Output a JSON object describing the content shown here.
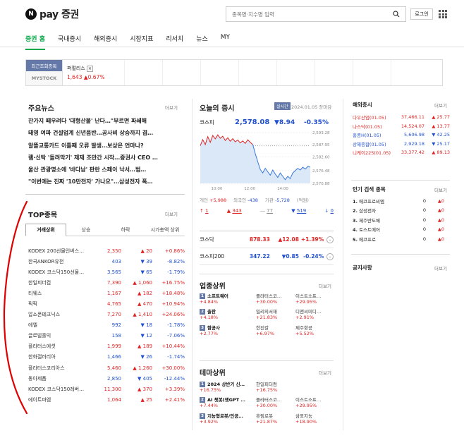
{
  "header": {
    "logo_badge": "N",
    "logo_text": "pay 증권",
    "search_placeholder": "종목명·지수명 입력",
    "login": "로그인"
  },
  "nav": [
    "증권 홈",
    "국내증시",
    "해외증시",
    "시장지표",
    "리서치",
    "뉴스",
    "MY"
  ],
  "recent": {
    "title": "최근조회종목",
    "sub": "MYSTOCK",
    "stock_name": "퍼펄리스",
    "stock_price": "1,643",
    "stock_change": "▲0.67%"
  },
  "news": {
    "title": "주요뉴스",
    "more": "더보기",
    "items": [
      "잔가지 떼우려다 '대형산불' 난다…\"부르면 파쇄해",
      "태영 여파 건설업계 신년음반…공사비 상승까지 겹…",
      "알뜰교통카드 이틀째 오류 발생…보상은 언마나?",
      "램·신탁 '돌려막기' 제재 조만간 시작…증권사 CEO …",
      "울산 관광명소에 '바다남' 판란 스페이 낙서…범…",
      "\"이번에는 진짜 '10만전자' 가나요\"…삼성전자 폭…"
    ]
  },
  "top": {
    "title": "TOP종목",
    "more": "더보기",
    "tabs": [
      "거래상위",
      "상승",
      "하락",
      "시가총액 상위"
    ],
    "rows": [
      {
        "name": "KODEX 200선물인버스…",
        "price": "2,350",
        "change": "▲ 20",
        "rate": "+0.86%",
        "dir": "up"
      },
      {
        "name": "한국ANKOR유전",
        "price": "403",
        "change": "▼ 39",
        "rate": "-8.82%",
        "dir": "down"
      },
      {
        "name": "KODEX 코스닥150선물…",
        "price": "3,565",
        "change": "▼ 65",
        "rate": "-1.79%",
        "dir": "down"
      },
      {
        "name": "한일피더컴",
        "price": "7,390",
        "change": "▲ 1,060",
        "rate": "+16.75%",
        "dir": "up"
      },
      {
        "name": "티웨스",
        "price": "1,167",
        "change": "▲ 182",
        "rate": "+18.48%",
        "dir": "up"
      },
      {
        "name": "픽픽",
        "price": "4,765",
        "change": "▲ 470",
        "rate": "+10.94%",
        "dir": "up"
      },
      {
        "name": "압소폰테크닉스",
        "price": "7,270",
        "change": "▲ 1,410",
        "rate": "+24.06%",
        "dir": "up"
      },
      {
        "name": "에엘",
        "price": "992",
        "change": "▼ 18",
        "rate": "-1.78%",
        "dir": "down"
      },
      {
        "name": "글로벌홀익",
        "price": "158",
        "change": "▼ 12",
        "rate": "-7.06%",
        "dir": "down"
      },
      {
        "name": "플라터스에셋",
        "price": "1,999",
        "change": "▲ 189",
        "rate": "+10.44%",
        "dir": "up"
      },
      {
        "name": "한화갤러리아",
        "price": "1,466",
        "change": "▼ 26",
        "rate": "-1.74%",
        "dir": "down"
      },
      {
        "name": "플라터스코리아스",
        "price": "5,460",
        "change": "▲ 1,260",
        "rate": "+30.00%",
        "dir": "up"
      },
      {
        "name": "동아제품",
        "price": "2,850",
        "change": "▼ 405",
        "rate": "-12.44%",
        "dir": "down"
      },
      {
        "name": "KODEX 코스닥150레버…",
        "price": "11,300",
        "change": "▲ 370",
        "rate": "+3.39%",
        "dir": "up"
      },
      {
        "name": "에이트파엠",
        "price": "1,064",
        "change": "▲ 25",
        "rate": "+2.41%",
        "dir": "up"
      }
    ]
  },
  "market": {
    "title": "오늘의 증시",
    "badge": "실시간",
    "date": "2024.01.05 장마감",
    "kospi_label": "코스피",
    "kospi_value": "2,578.08",
    "kospi_change": "▼8.94",
    "kospi_rate": "-0.35%",
    "y_ticks": [
      "2,593.28",
      "2,587.95",
      "2,582.60",
      "2,576.48",
      "2,570.88"
    ],
    "x_ticks": [
      "10:00",
      "12:00",
      "14:00"
    ],
    "investors": [
      {
        "label": "개인",
        "value": "+5,988",
        "dir": "up"
      },
      {
        "label": "외국인",
        "value": "-438",
        "dir": "down"
      },
      {
        "label": "기관",
        "value": "-5,728",
        "dir": "down"
      },
      {
        "label": "",
        "value": "(억원)",
        "dir": "none"
      }
    ],
    "breadth": [
      {
        "sym": "↑",
        "value": "1",
        "dir": "up"
      },
      {
        "sym": "▲",
        "value": "343",
        "dir": "up"
      },
      {
        "sym": "―",
        "value": "77",
        "dir": "none"
      },
      {
        "sym": "▼",
        "value": "519",
        "dir": "down"
      },
      {
        "sym": "↓",
        "value": "0",
        "dir": "down"
      }
    ],
    "indices": [
      {
        "name": "코스닥",
        "value": "878.33",
        "change": "▲12.08",
        "rate": "+1.39%",
        "dir": "up"
      },
      {
        "name": "코스피200",
        "value": "347.22",
        "change": "▼0.85",
        "rate": "-0.24%",
        "dir": "down"
      }
    ]
  },
  "chart_data": {
    "type": "area",
    "title": "",
    "xlabel": "",
    "ylabel": "",
    "x_ticks": [
      "10:00",
      "12:00",
      "14:00"
    ],
    "y_ticks": [
      2593.28,
      2587.95,
      2582.6,
      2576.48,
      2570.88
    ],
    "ylim": [
      2570.88,
      2593.28
    ],
    "values": [
      2587.5,
      2590.2,
      2588.0,
      2591.5,
      2589.0,
      2592.0,
      2590.5,
      2592.3,
      2590.8,
      2591.7,
      2589.8,
      2591.0,
      2589.5,
      2590.6,
      2589.2,
      2590.0,
      2588.8,
      2589.6,
      2588.5,
      2590.1,
      2589.0,
      2588.0,
      2584.0,
      2580.5,
      2577.0,
      2575.5,
      2577.5,
      2576.0,
      2574.5,
      2576.8,
      2575.0,
      2573.5,
      2575.5,
      2574.0,
      2572.5,
      2574.0,
      2573.0,
      2575.5,
      2576.5,
      2577.5,
      2576.8,
      2578.0,
      2577.2,
      2578.3,
      2578.08
    ]
  },
  "sector": {
    "title": "업종상위",
    "more": "더보기",
    "rows": [
      [
        {
          "rank": "1",
          "name": "소프트웨어",
          "rate": "+4.84%"
        },
        {
          "name": "플라터스코…",
          "rate": "+30.00%"
        },
        {
          "name": "이스트소프…",
          "rate": "+29.95%"
        }
      ],
      [
        {
          "rank": "2",
          "name": "출판",
          "rate": "+4.18%"
        },
        {
          "name": "밀리의서재",
          "rate": "+21.83%"
        },
        {
          "name": "디앤씨미디…",
          "rate": "+2.91%"
        }
      ],
      [
        {
          "rank": "3",
          "name": "항공사",
          "rate": "+2.77%"
        },
        {
          "name": "한진칼",
          "rate": "+6.97%"
        },
        {
          "name": "제주항공",
          "rate": "+5.52%"
        }
      ]
    ]
  },
  "theme": {
    "title": "테마상위",
    "more": "더보기",
    "rows": [
      [
        {
          "rank": "1",
          "name": "2024 상반기 신…",
          "rate": "+16.75%"
        },
        {
          "name": "한일피더컴",
          "rate": "+16.75%"
        },
        {
          "name": "",
          "rate": ""
        }
      ],
      [
        {
          "rank": "2",
          "name": "AI 챗봇(챗GPT …",
          "rate": "+7.44%"
        },
        {
          "name": "플라터스코…",
          "rate": "+30.00%"
        },
        {
          "name": "이스트소프…",
          "rate": "+29.95%"
        }
      ],
      [
        {
          "rank": "3",
          "name": "지능형로봇/인공…",
          "rate": "+3.92%"
        },
        {
          "name": "휴림로봇",
          "rate": "+21.87%"
        },
        {
          "name": "삼표지능",
          "rate": "+18.90%"
        }
      ]
    ]
  },
  "overseas": {
    "title": "해외증시",
    "more": "더보기",
    "rows": [
      {
        "name": "다우산업(01.05)",
        "value": "37,466.11",
        "change": "▲ 25.77",
        "dir": "up"
      },
      {
        "name": "나스닥(01.05)",
        "value": "14,524.07",
        "change": "▲ 13.77",
        "dir": "up"
      },
      {
        "name": "홍콩H(01.05)",
        "value": "5,606.98",
        "change": "▼ 42.25",
        "dir": "down"
      },
      {
        "name": "상해종합(01.05)",
        "value": "2,929.18",
        "change": "▼ 25.17",
        "dir": "down"
      },
      {
        "name": "니케이225(01.05)",
        "value": "33,377.42",
        "change": "▲ 89.13",
        "dir": "up"
      }
    ]
  },
  "popular": {
    "title": "인기 검색 종목",
    "more": "더보기",
    "rows": [
      {
        "rank": "1.",
        "name": "에코프로비엠",
        "a": "0",
        "b": "▲0"
      },
      {
        "rank": "2.",
        "name": "삼성전자",
        "a": "0",
        "b": "▲0"
      },
      {
        "rank": "3.",
        "name": "제주반도체",
        "a": "0",
        "b": "▲0"
      },
      {
        "rank": "4.",
        "name": "토스트에어",
        "a": "0",
        "b": "▲0"
      },
      {
        "rank": "5.",
        "name": "에코프로",
        "a": "0",
        "b": "▲0"
      }
    ]
  },
  "notice": {
    "title": "공지사항",
    "more": "더보기"
  },
  "colors": {
    "up": "#e02424",
    "down": "#2050d0",
    "accent": "#0aa84a",
    "badge": "#6579a8",
    "annotation": "#e00000"
  }
}
